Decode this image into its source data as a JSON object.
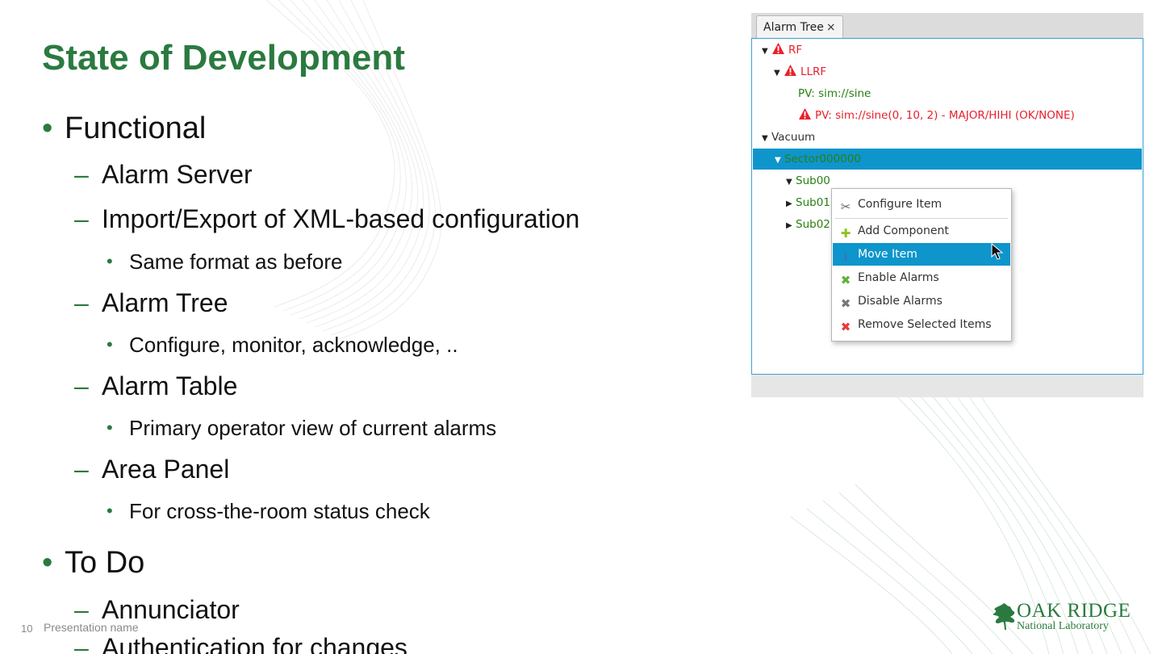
{
  "slide": {
    "title": "State of Development",
    "bullets": [
      {
        "text": "Functional"
      },
      {
        "text": "Alarm Server"
      },
      {
        "text": "Import/Export of XML-based configuration"
      },
      {
        "text": "Same format as before"
      },
      {
        "text": "Alarm Tree"
      },
      {
        "text": "Configure, monitor, acknowledge, .."
      },
      {
        "text": "Alarm Table"
      },
      {
        "text": "Primary operator view of current alarms"
      },
      {
        "text": "Area Panel"
      },
      {
        "text": "For cross-the-room status check"
      },
      {
        "text": "To Do"
      },
      {
        "text": "Annunciator"
      },
      {
        "text": "Authentication for changes"
      }
    ],
    "bullet_marks": {
      "level1": "•",
      "level2": "–",
      "level3": "•"
    },
    "footer": {
      "page_number": "10",
      "presentation_name": "Presentation name"
    },
    "logo": {
      "line1": "OAK RIDGE",
      "line2": "National Laboratory"
    },
    "accent_color": "#2a7a3f"
  },
  "screenshot": {
    "tab": {
      "label": "Alarm Tree",
      "close": "×"
    },
    "tree": [
      {
        "label": "RF",
        "status": "alarm"
      },
      {
        "label": "LLRF",
        "status": "alarm"
      },
      {
        "label": "PV: sim://sine",
        "status": "ok"
      },
      {
        "label": "PV: sim://sine(0, 10, 2) - MAJOR/HIHI (OK/NONE)",
        "status": "alarm"
      },
      {
        "label": "Vacuum",
        "status": "normal"
      },
      {
        "label": "Sector000000",
        "status": "ok",
        "selected": true
      },
      {
        "label": "Sub00",
        "status": "ok"
      },
      {
        "label": "Sub01",
        "status": "ok"
      },
      {
        "label": "Sub02",
        "status": "ok"
      }
    ],
    "context_menu": [
      {
        "label": "Configure Item",
        "icon": "tools-icon"
      },
      {
        "label": "Add Component",
        "icon": "plus-icon"
      },
      {
        "label": "Move Item",
        "icon": "move-icon",
        "highlighted": true
      },
      {
        "label": "Enable Alarms",
        "icon": "green-x-icon"
      },
      {
        "label": "Disable Alarms",
        "icon": "gray-x-icon"
      },
      {
        "label": "Remove Selected Items",
        "icon": "red-x-icon"
      }
    ],
    "colors": {
      "alarm": "#e8202b",
      "ok": "#2a7f12",
      "selection": "#0e95cc"
    }
  }
}
